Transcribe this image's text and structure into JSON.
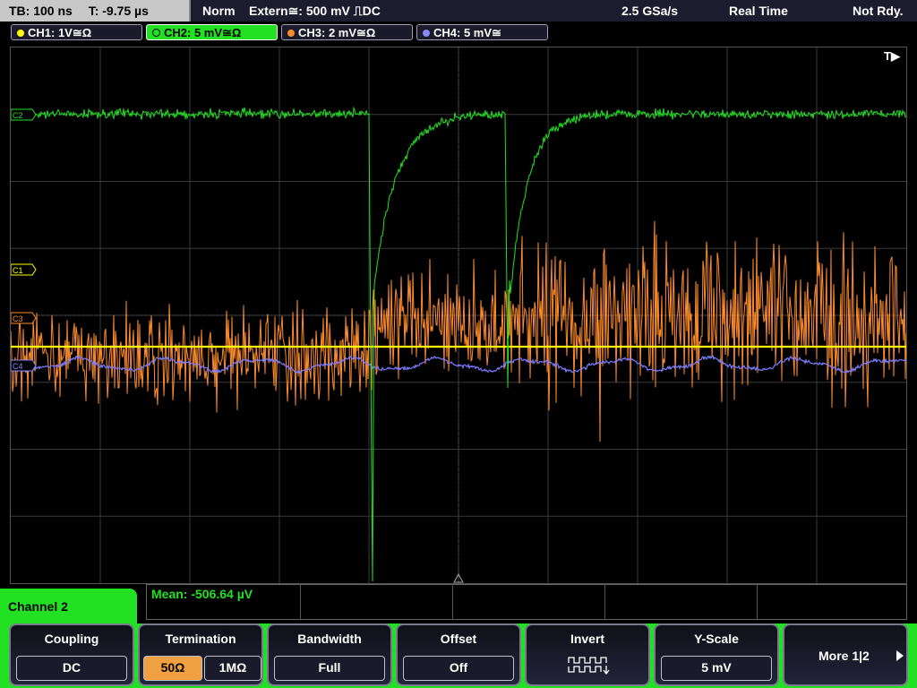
{
  "status_bar": {
    "timebase": "TB: 100 ns",
    "trigger_time": "T: -9.75 µs",
    "trigger_mode": "Norm",
    "trigger_source": "Extern≅: 500 mV ⎍DC",
    "sample_rate": "2.5 GSa/s",
    "acq_mode": "Real Time",
    "status": "Not Rdy."
  },
  "channels": [
    {
      "label": "CH1: 1V≅Ω",
      "color": "#ffff00"
    },
    {
      "label": "CH2: 5 mV≅Ω",
      "color": "#22e022"
    },
    {
      "label": "CH3: 2 mV≅Ω",
      "color": "#ff8c2a"
    },
    {
      "label": "CH4: 5 mV≅",
      "color": "#8888ff"
    }
  ],
  "trace_markers": {
    "c1": "C1",
    "c2": "C2",
    "c3": "C3",
    "c4": "C4",
    "trigger": "T▶"
  },
  "menu_title": "Channel 2",
  "measurement": {
    "mean": "Mean: -506.64 µV"
  },
  "softkeys": {
    "coupling": {
      "title": "Coupling",
      "value": "DC"
    },
    "termination": {
      "title": "Termination",
      "options": [
        "50Ω",
        "1MΩ"
      ],
      "selected": "50Ω"
    },
    "bandwidth": {
      "title": "Bandwidth",
      "value": "Full"
    },
    "offset": {
      "title": "Offset",
      "value": "Off"
    },
    "invert": {
      "title": "Invert",
      "icon": "invert-waveform-icon"
    },
    "yscale": {
      "title": "Y-Scale",
      "value": "5 mV"
    },
    "more": {
      "label": "More 1|2"
    }
  }
}
